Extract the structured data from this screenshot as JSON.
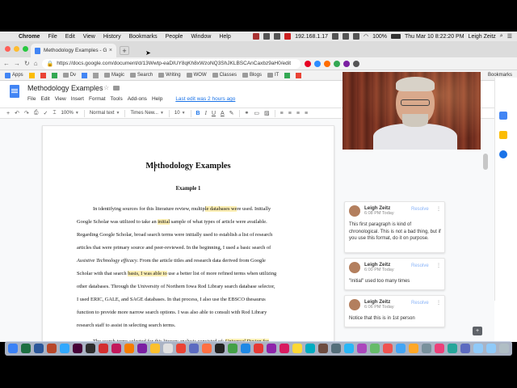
{
  "menubar": {
    "app": "Chrome",
    "items": [
      "File",
      "Edit",
      "View",
      "History",
      "Bookmarks",
      "People",
      "Window",
      "Help"
    ],
    "ip": "192.168.1.17",
    "battery": "100%",
    "datetime": "Thu Mar 10  8:22:20 PM",
    "user": "Leigh Zeitz"
  },
  "browser": {
    "tab_title": "Methodology Examples - Goo",
    "tab_close": "×",
    "new_tab": "+",
    "url": "https://docs.google.com/document/d/13Wwtp-eaDIUY8qKh8xWzoNQ3ShJKLBSCAnCaxbz9aH0/edit",
    "bookmarks": [
      "Apps",
      "Dv",
      "Magic",
      "Search",
      "Writing",
      "WOW",
      "Classes",
      "Blogs",
      "IT"
    ],
    "bookmarks_right": "Bookmarks"
  },
  "docs": {
    "title": "Methodology Examples",
    "menu": [
      "File",
      "Edit",
      "View",
      "Insert",
      "Format",
      "Tools",
      "Add-ons",
      "Help"
    ],
    "last_edit": "Last edit was 2 hours ago",
    "toolbar": {
      "zoom": "100%",
      "style": "Normal text",
      "font": "Times New...",
      "size": "10",
      "bold": "B",
      "italic": "I",
      "underline": "U",
      "color": "A"
    }
  },
  "document": {
    "heading": "Methodology Examples",
    "subheading": "Example 1",
    "lines": [
      {
        "parts": [
          {
            "t": "In identifying sources for this literature review, multip"
          },
          {
            "t": "le databases we",
            "hl": true
          },
          {
            "t": "re used.  Initially"
          }
        ]
      },
      {
        "parts": [
          {
            "t": "Google Scholar was utilized to take an "
          },
          {
            "t": "initial",
            "hl": true
          },
          {
            "t": " sample of what types of article were available."
          }
        ]
      },
      {
        "parts": [
          {
            "t": "Regarding Google Scholar, broad search terms were initially used to establish a list of research"
          }
        ]
      },
      {
        "parts": [
          {
            "t": "articles that were primary source and peer-reviewed.  In the beginning, I used a basic search of"
          }
        ]
      },
      {
        "parts": [
          {
            "t": "Assistive Technology efficacy",
            "i": true
          },
          {
            "t": ".  From the article titles and research data derived from Google"
          }
        ]
      },
      {
        "parts": [
          {
            "t": "Scholar with that search "
          },
          {
            "t": "basis, I was able to",
            "hl": true
          },
          {
            "t": " use a better list of more refined terms when utilizing"
          }
        ]
      },
      {
        "parts": [
          {
            "t": "other databases.  Through the University of Northern Iowa Rod Library search database selector,"
          }
        ]
      },
      {
        "parts": [
          {
            "t": "I used ERIC, GALE, and SAGE databases.  In that process, I also use the EBSCO thesaurus"
          }
        ]
      },
      {
        "parts": [
          {
            "t": "function to provide more narrow search options.  I was also able to consult with Rod Library"
          }
        ]
      },
      {
        "parts": [
          {
            "t": "research staff to assist in selecting search terms."
          }
        ]
      },
      {
        "parts": [
          {
            "t": "The search terms selected for this literary analysis consisted of: "
          },
          {
            "t": "Universal Design for",
            "i": true,
            "u": true,
            "hl": true
          }
        ]
      }
    ]
  },
  "comments": [
    {
      "author": "Leigh Zeitz",
      "time": "6:08 PM Today",
      "resolve": "Resolve",
      "text": "This first paragraph is kind of chronological. This is not a bad thing, but if you use this format, do it on purpose."
    },
    {
      "author": "Leigh Zeitz",
      "time": "6:00 PM Today",
      "resolve": "Resolve",
      "text": "\"Initial\" used too many times"
    },
    {
      "author": "Leigh Zeitz",
      "time": "6:06 PM Today",
      "resolve": "Resolve",
      "text": "Notice that this is in 1st person"
    }
  ],
  "colors": {
    "accent": "#1a73e8",
    "highlight": "#fdefb4",
    "docs_blue": "#4285f4"
  }
}
